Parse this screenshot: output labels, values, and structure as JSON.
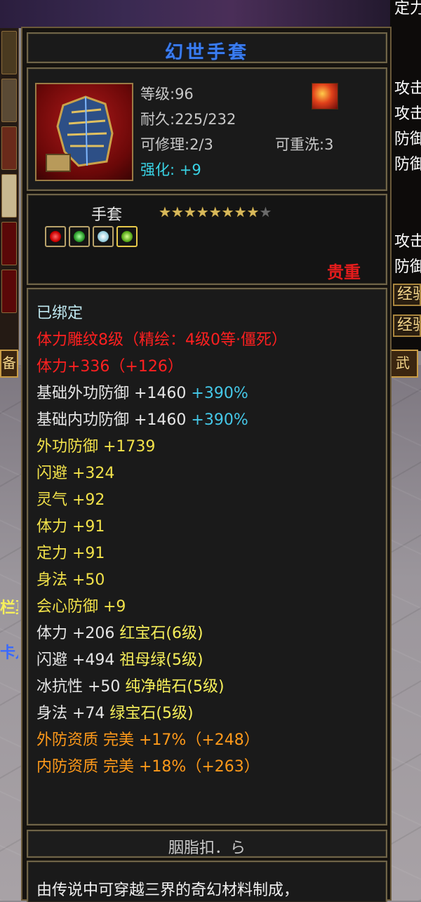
{
  "background": {
    "right_panel": {
      "lines": [
        "定力",
        "",
        "攻击",
        "攻击",
        "防御",
        "防御",
        "",
        "",
        "攻击",
        "防御"
      ],
      "buttons": [
        "经验",
        "经验"
      ]
    },
    "left_tab_label": "备",
    "left_names": [
      "栏莫",
      "卡八"
    ],
    "right_tab_label": "武"
  },
  "tooltip": {
    "title": "幻世手套",
    "icon": "gauntlet-icon",
    "stats": {
      "level": "等级:96",
      "durability": "耐久:225/232",
      "repairable": "可修理:2/3",
      "rewashable": "可重洗:3",
      "enhance": "强化: +9"
    },
    "type": "手套",
    "stars_total": 9,
    "stars_filled": 8,
    "stars_text": "★★★★★★★★",
    "stars_off_text": "★",
    "gems": [
      "red-gem-icon",
      "green-gem-icon",
      "white-gem-icon",
      "lime-gem-icon"
    ],
    "rarity": "贵重",
    "attributes": [
      {
        "text": "已绑定",
        "color": "cyan"
      },
      {
        "text": "体力雕纹8级（精绘：4级0等·僵死）",
        "color": "red"
      },
      {
        "text": "体力+336（+126）",
        "color": "red"
      },
      {
        "text": "基础外功防御 +1460",
        "color": "white",
        "extra": "+390%"
      },
      {
        "text": "基础内功防御 +1460",
        "color": "white",
        "extra": "+390%"
      },
      {
        "text": "外功防御 +1739",
        "color": "yellow"
      },
      {
        "text": "闪避 +324",
        "color": "yellow"
      },
      {
        "text": "灵气 +92",
        "color": "yellow"
      },
      {
        "text": "体力 +91",
        "color": "yellow"
      },
      {
        "text": "定力 +91",
        "color": "yellow"
      },
      {
        "text": "身法 +50",
        "color": "yellow"
      },
      {
        "text": "会心防御 +9",
        "color": "yellow"
      },
      {
        "text": "体力 +206",
        "color": "white",
        "gem": "红宝石(6级)"
      },
      {
        "text": "闪避 +494",
        "color": "white",
        "gem": "祖母绿(5级)"
      },
      {
        "text": "冰抗性 +50",
        "color": "white",
        "gem": "纯净皓石(5级)"
      },
      {
        "text": "身法 +74",
        "color": "white",
        "gem": "绿宝石(5级)"
      },
      {
        "text": "外防资质  完美 +17%（+248）",
        "color": "orange"
      },
      {
        "text": "内防资质  完美 +18%（+263）",
        "color": "orange"
      }
    ],
    "author": "胭脂扣．ら",
    "description": "由传说中可穿越三界的奇幻材料制成，"
  }
}
